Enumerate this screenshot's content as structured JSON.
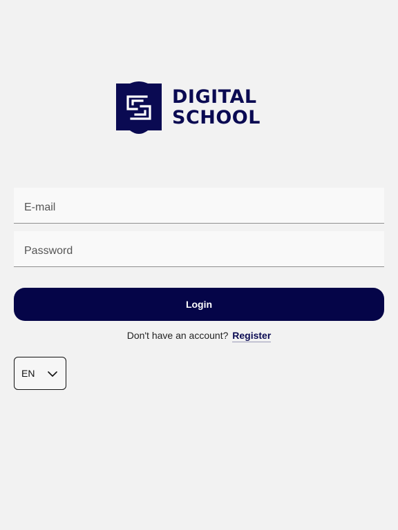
{
  "logo": {
    "line1": "DIGITAL",
    "line2": "SCHOOL",
    "icon": "shield-logo-icon"
  },
  "form": {
    "email_placeholder": "E-mail",
    "email_value": "",
    "password_placeholder": "Password",
    "password_value": ""
  },
  "login": {
    "label": "Login"
  },
  "register": {
    "prompt": "Don't have an account?",
    "link_label": "Register"
  },
  "language": {
    "selected": "EN",
    "icon": "chevron-down-icon"
  },
  "colors": {
    "brand": "#050548",
    "background": "#f2f2f2"
  }
}
